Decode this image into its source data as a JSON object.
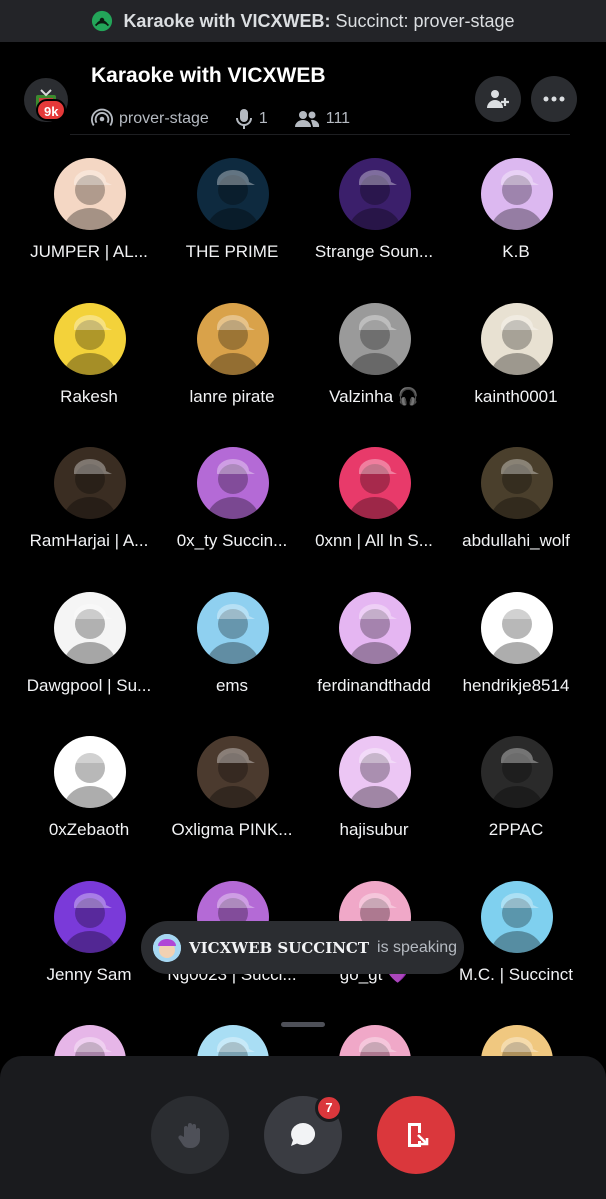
{
  "topbar": {
    "title_bold": "Karaoke with VICXWEB:",
    "title_rest": " Succinct: prover-stage"
  },
  "header": {
    "server_badge": "9k",
    "stage_title": "Karaoke with VICXWEB",
    "channel_name": "prover-stage",
    "speaker_count": "1",
    "listener_count": "111"
  },
  "participants": [
    {
      "name": "JUMPER | AL...",
      "color": "#f4d7c4"
    },
    {
      "name": "THE PRIME",
      "color": "#0e2a3f"
    },
    {
      "name": "Strange Soun...",
      "color": "#3b1f6b"
    },
    {
      "name": "K.B",
      "color": "#dcb8f0"
    },
    {
      "name": "Rakesh",
      "color": "#f3d23a"
    },
    {
      "name": "lanre pirate",
      "color": "#d9a24a"
    },
    {
      "name": "Valzinha 🎧",
      "color": "#9a9a9a"
    },
    {
      "name": "kainth0001",
      "color": "#e8e1d2"
    },
    {
      "name": "RamHarjai | A...",
      "color": "#3a2d22"
    },
    {
      "name": "0x_ty  Succin...",
      "color": "#b46ad6"
    },
    {
      "name": "0xnn | All In S...",
      "color": "#e83a6a"
    },
    {
      "name": "abdullahi_wolf",
      "color": "#4a3f2c"
    },
    {
      "name": "Dawgpool | Su...",
      "color": "#f5f5f5"
    },
    {
      "name": "ems",
      "color": "#8fd0f0"
    },
    {
      "name": "ferdinandthadd",
      "color": "#e5b6f2"
    },
    {
      "name": "hendrikje8514",
      "color": "#ffffff"
    },
    {
      "name": "0xZebaoth",
      "color": "#ffffff"
    },
    {
      "name": "Oxligma PINK...",
      "color": "#4b3a2e"
    },
    {
      "name": "hajisubur",
      "color": "#ecc6f4"
    },
    {
      "name": "2PPAC",
      "color": "#2a2a2a"
    },
    {
      "name": "Jenny Sam",
      "color": "#7a3ad9"
    },
    {
      "name": "Ng0023 | Succi...",
      "color": "#b46ad6"
    },
    {
      "name": "go_gt 💜",
      "color": "#f0a8c8"
    },
    {
      "name": "M.C. | Succinct",
      "color": "#7fd0ef"
    },
    {
      "name": "",
      "color": "#e6b6e8"
    },
    {
      "name": "",
      "color": "#a9def4"
    },
    {
      "name": "",
      "color": "#f0a8c8"
    },
    {
      "name": "",
      "color": "#f0c880"
    }
  ],
  "toast": {
    "speaker": "VICXWEB SUCCINCT",
    "status": "is speaking"
  },
  "controls": {
    "chat_badge": "7"
  },
  "colors": {
    "accent_green": "#23a559",
    "leave_red": "#da373c",
    "badge_red": "#e53939"
  }
}
